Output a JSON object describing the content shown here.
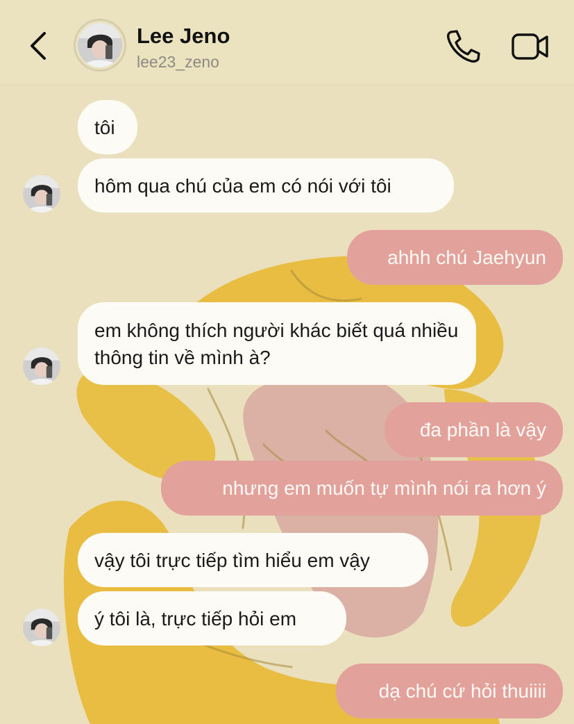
{
  "header": {
    "name": "Lee Jeno",
    "username": "lee23_zeno"
  },
  "messages": [
    {
      "side": "in",
      "text": "tôi"
    },
    {
      "side": "in",
      "text": "hôm qua chú của em có nói với tôi"
    },
    {
      "side": "out",
      "text": "ahhh chú Jaehyun"
    },
    {
      "side": "in",
      "text": "em không thích người khác biết quá nhiều thông tin về mình à?"
    },
    {
      "side": "out",
      "text": "đa phần là vậy"
    },
    {
      "side": "out",
      "text": "nhưng em muốn tự mình nói ra hơn ý"
    },
    {
      "side": "in",
      "text": "vậy tôi trực tiếp tìm hiểu em vậy"
    },
    {
      "side": "in",
      "text": "ý tôi là, trực tiếp hỏi em"
    },
    {
      "side": "out",
      "text": "dạ chú cứ hỏi thuiiii"
    }
  ],
  "colors": {
    "background": "#ebe0bd",
    "incoming_bubble": "#fdfbf5",
    "outgoing_bubble": "#e3a19b"
  },
  "icons": {
    "back": "chevron-left-icon",
    "call": "phone-icon",
    "video": "video-camera-icon"
  }
}
